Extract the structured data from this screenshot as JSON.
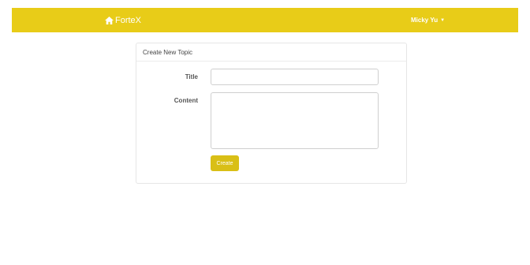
{
  "navbar": {
    "brand": "ForteX",
    "brand_icon": "home-icon",
    "user_name": "Micky Yu",
    "caret": "▼",
    "color": "#e8cc18"
  },
  "panel": {
    "heading": "Create New Topic"
  },
  "form": {
    "title_label": "Title",
    "title_value": "",
    "content_label": "Content",
    "content_value": "",
    "submit_label": "Create",
    "button_color": "#d9bf16"
  }
}
